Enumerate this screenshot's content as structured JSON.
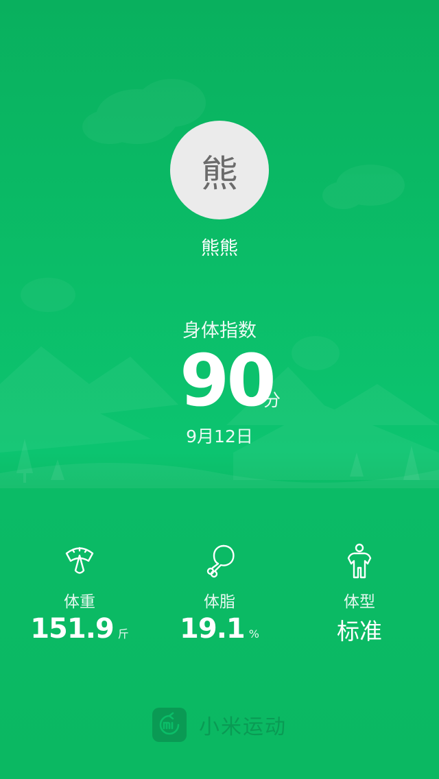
{
  "profile": {
    "avatar_char": "熊",
    "name": "熊熊"
  },
  "score": {
    "label": "身体指数",
    "value": "90",
    "unit": "分",
    "date": "9月12日"
  },
  "stats": [
    {
      "icon": "scale-icon",
      "label": "体重",
      "value": "151.9",
      "unit": "斤"
    },
    {
      "icon": "drumstick-icon",
      "label": "体脂",
      "value": "19.1",
      "unit": "%"
    },
    {
      "icon": "body-type-icon",
      "label": "体型",
      "value": "标准",
      "unit": ""
    }
  ],
  "footer": {
    "logo_icon": "mi-logo-icon",
    "app_name": "小米运动"
  },
  "colors": {
    "background": "#0ab35f",
    "text": "#ffffff",
    "avatar_bg": "#ebebeb",
    "footer": "#0a9a54"
  }
}
